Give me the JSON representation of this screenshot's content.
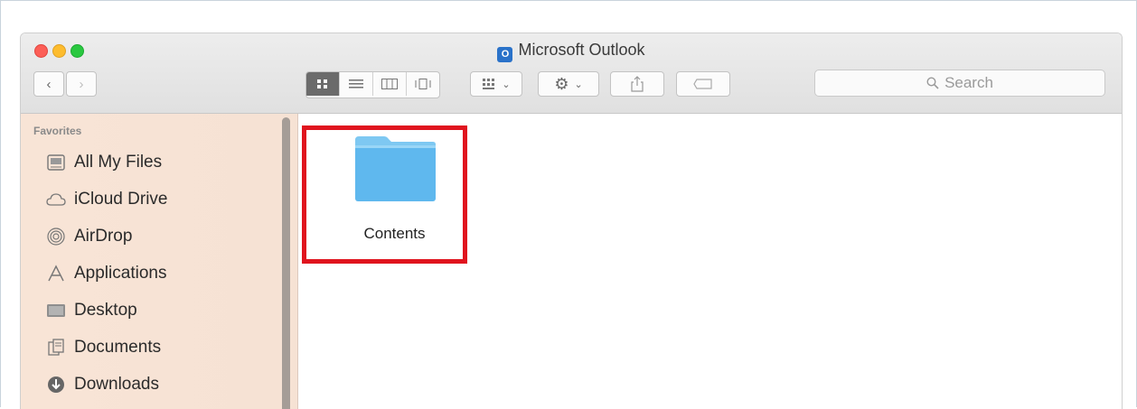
{
  "window": {
    "title": "Microsoft Outlook",
    "app_icon": "outlook-icon"
  },
  "toolbar": {
    "back_icon": "‹",
    "forward_icon": "›",
    "view_modes": [
      "icon-view",
      "list-view",
      "column-view",
      "cover-flow-view"
    ],
    "active_view": "icon-view",
    "search_placeholder": "Search"
  },
  "sidebar": {
    "heading": "Favorites",
    "items": [
      {
        "label": "All My Files",
        "icon": "all-files-icon"
      },
      {
        "label": "iCloud Drive",
        "icon": "cloud-icon"
      },
      {
        "label": "AirDrop",
        "icon": "airdrop-icon"
      },
      {
        "label": "Applications",
        "icon": "applications-icon"
      },
      {
        "label": "Desktop",
        "icon": "desktop-icon"
      },
      {
        "label": "Documents",
        "icon": "documents-icon"
      },
      {
        "label": "Downloads",
        "icon": "downloads-icon"
      }
    ]
  },
  "content": {
    "items": [
      {
        "label": "Contents",
        "icon": "folder-icon",
        "highlighted": true
      }
    ]
  },
  "colors": {
    "highlight": "#e0141e",
    "folder": "#5fb8ee",
    "sidebar_bg": "#f8e4d6"
  }
}
